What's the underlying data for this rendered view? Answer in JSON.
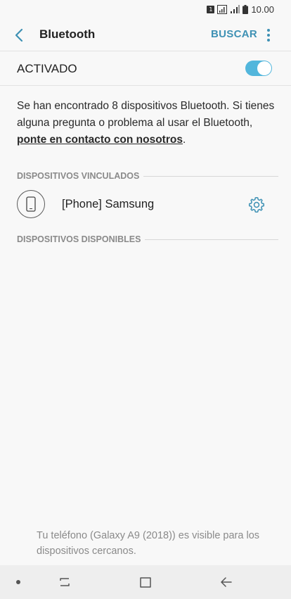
{
  "status_bar": {
    "sim": "1",
    "time": "10.00"
  },
  "app_bar": {
    "title": "Bluetooth",
    "search_label": "BUSCAR"
  },
  "toggle": {
    "label": "ACTIVADO",
    "enabled": true
  },
  "info": {
    "text_before": "Se han encontrado 8 dispositivos Bluetooth. Si tienes alguna pregunta o problema al usar el Bluetooth, ",
    "link": "ponte en contacto con nosotros",
    "text_after": "."
  },
  "paired": {
    "header": "DISPOSITIVOS VINCULADOS",
    "devices": [
      {
        "name": "[Phone] Samsung"
      }
    ]
  },
  "available": {
    "header": "DISPOSITIVOS DISPONIBLES"
  },
  "footer_note": "Tu teléfono (Galaxy A9 (2018)) es visible para los dispositivos cercanos.",
  "colors": {
    "accent": "#3e91b4",
    "switch_on": "#52b6dc"
  }
}
